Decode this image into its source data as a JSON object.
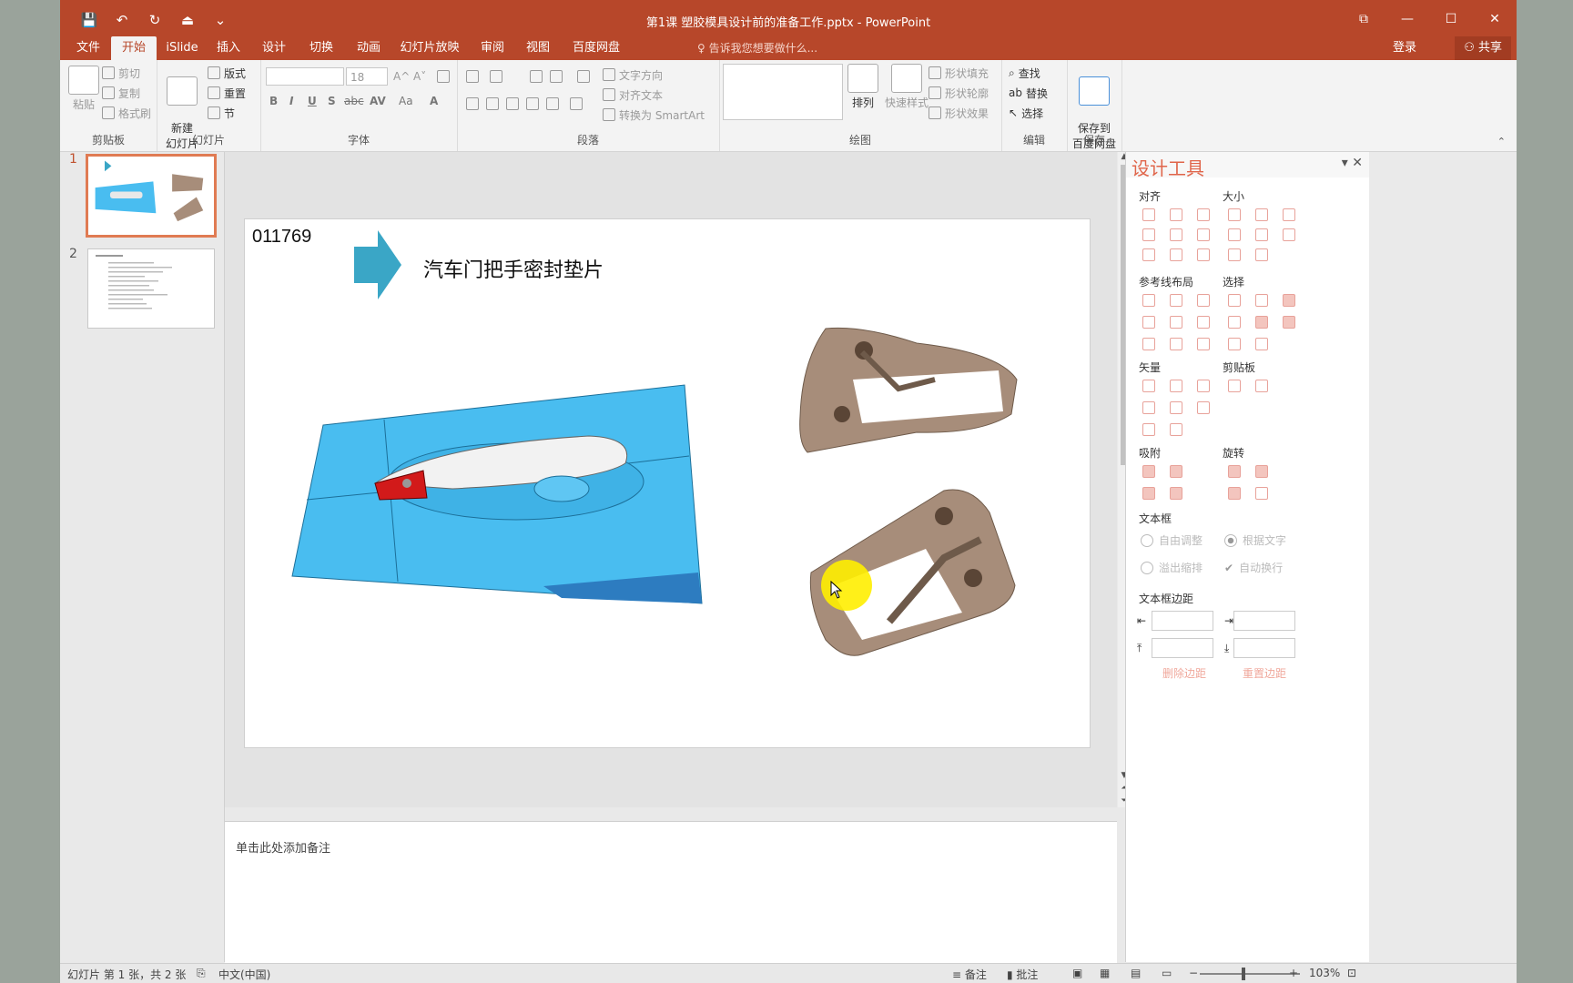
{
  "window": {
    "title": "第1课 塑胶模具设计前的准备工作.pptx - PowerPoint",
    "controls": [
      "⧉",
      "—",
      "☐",
      "✕"
    ]
  },
  "qat": {
    "save": "💾",
    "undo": "↶",
    "redo": "↻",
    "present": "⏏",
    "more": "⌄"
  },
  "tabs": [
    "文件",
    "开始",
    "iSlide",
    "插入",
    "设计",
    "切换",
    "动画",
    "幻灯片放映",
    "审阅",
    "视图",
    "百度网盘"
  ],
  "active_tab": "开始",
  "tellme": "♀ 告诉我您想要做什么...",
  "login": "登录",
  "share": "⚇ 共享",
  "ribbon": {
    "clipboard": {
      "paste": "粘贴",
      "cut": "剪切",
      "copy": "复制",
      "format_painter": "格式刷",
      "label": "剪贴板"
    },
    "slides": {
      "new_slide": "新建\n幻灯片",
      "layout": "版式",
      "reset": "重置",
      "section": "节",
      "label": "幻灯片"
    },
    "font": {
      "font_size": "18",
      "label": "字体",
      "bold": "B",
      "italic": "I",
      "underline": "U",
      "shadow": "S",
      "strike": "abc",
      "spacing": "AV",
      "case": "Aa",
      "color": "A"
    },
    "paragraph": {
      "text_dir": "文字方向",
      "align_text": "对齐文本",
      "smartart": "转换为 SmartArt",
      "label": "段落"
    },
    "drawing": {
      "arrange": "排列",
      "quick_styles": "快速样式",
      "fill": "形状填充",
      "outline": "形状轮廓",
      "effects": "形状效果",
      "label": "绘图"
    },
    "editing": {
      "find": "查找",
      "replace": "替换",
      "select": "选择",
      "label": "编辑"
    },
    "save": {
      "save_to": "保存到\n百度网盘",
      "label": "保存"
    }
  },
  "thumbs": {
    "n1": "1",
    "n2": "2"
  },
  "slide": {
    "id_text": "011769",
    "title": "汽车门把手密封垫片"
  },
  "notes_placeholder": "单击此处添加备注",
  "panel": {
    "title": "设计工具",
    "sections": {
      "align": "对齐",
      "size": "大小",
      "guides": "参考线布局",
      "select": "选择",
      "vector": "矢量",
      "clipboard": "剪贴板",
      "snap": "吸附",
      "rotate": "旋转",
      "textbox": "文本框",
      "margins": "文本框边距"
    },
    "radios": {
      "free": "自由调整",
      "by_text": "根据文字",
      "overflow": "溢出缩排",
      "wrap": "自动换行"
    },
    "links": {
      "delete_margin": "删除边距",
      "reset_margin": "重置边距"
    }
  },
  "status": {
    "slide_info": "幻灯片 第 1 张，共 2 张",
    "lang": "中文(中国)",
    "notes": "备注",
    "comments": "批注",
    "zoom": "103%"
  },
  "colors": {
    "accent": "#b7472a",
    "panel_accent": "#e0654a",
    "door_blue": "#49bdf0",
    "gasket": "#a78d7a"
  }
}
